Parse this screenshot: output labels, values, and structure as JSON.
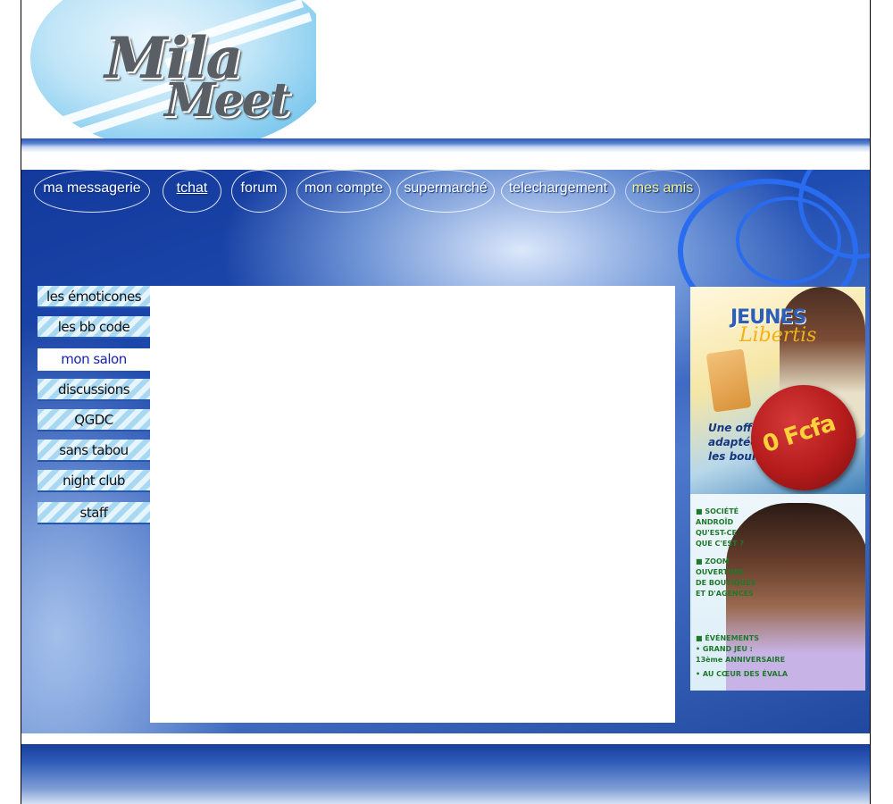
{
  "header": {
    "logo_line1": "Mila",
    "logo_line2": "Meet"
  },
  "nav": {
    "items": [
      {
        "label": "ma messagerie"
      },
      {
        "label": "tchat"
      },
      {
        "label": "forum"
      },
      {
        "label": "mon compte"
      },
      {
        "label": "supermarché"
      },
      {
        "label": "telechargement"
      },
      {
        "label": "mes amis"
      }
    ]
  },
  "sidebar": {
    "items": [
      {
        "label": "les émoticones"
      },
      {
        "label": "les bb code"
      },
      {
        "label": "mon salon"
      },
      {
        "label": "discussions"
      },
      {
        "label": "QGDC"
      },
      {
        "label": "sans tabou"
      },
      {
        "label": "night club"
      },
      {
        "label": "staff"
      }
    ]
  },
  "ads": {
    "ad1": {
      "title": "JEUNES",
      "subtitle": "Libertis",
      "copy_line1": "Une offr",
      "copy_line2": "adaptée",
      "copy_line3": "les bours",
      "sticker": "0 Fcfa"
    },
    "ad2": {
      "lines": [
        {
          "text": "■ SOCIÉTÉ",
          "head": true
        },
        {
          "text": "ANDROÏD",
          "head": false
        },
        {
          "text": "QU'EST-CE",
          "head": false
        },
        {
          "text": "QUE C'EST ?",
          "head": false
        },
        {
          "text": "■ ZOOM",
          "head": true
        },
        {
          "text": "OUVERTURE",
          "head": false
        },
        {
          "text": "DE BOUTIQUES",
          "head": false
        },
        {
          "text": "ET D'AGENCES",
          "head": false
        },
        {
          "text": "■ ÉVÉNEMENTS",
          "head": true
        },
        {
          "text": "• GRAND JEU :",
          "head": false
        },
        {
          "text": "13ème ANNIVERSAIRE",
          "head": false
        },
        {
          "text": "• AU CŒUR DES ÉVALA",
          "head": false
        }
      ]
    }
  }
}
